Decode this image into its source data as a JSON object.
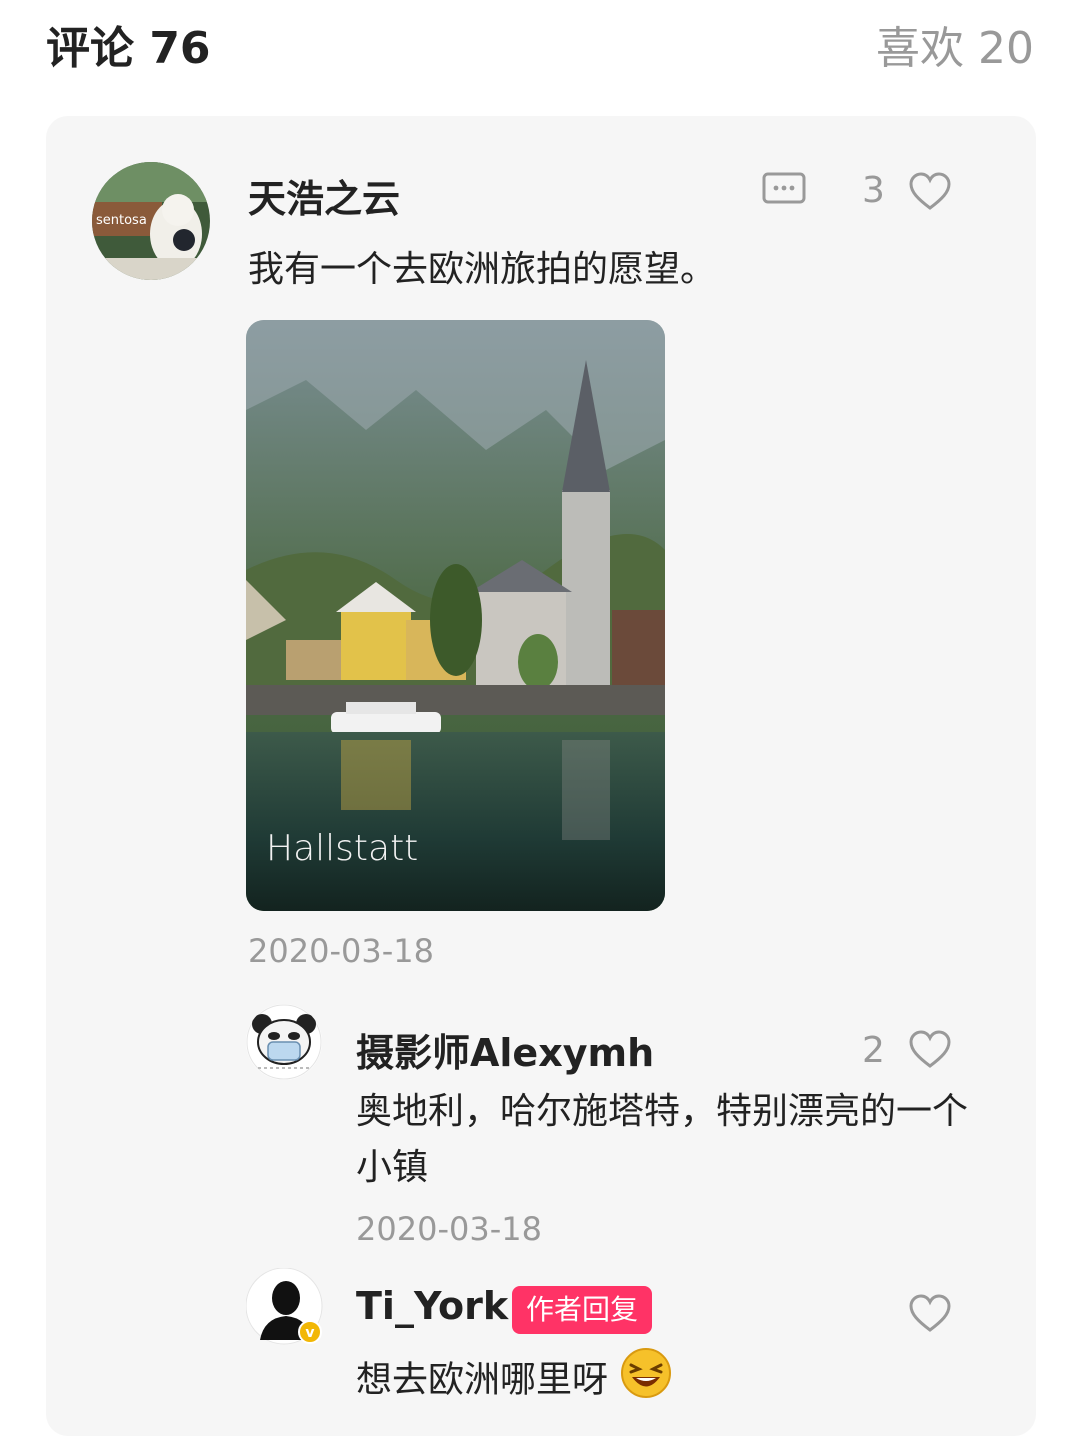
{
  "header": {
    "comments_label": "评论 76",
    "likes_label": "喜欢 20"
  },
  "comment": {
    "username": "天浩之云",
    "avatar_text": "sentosa",
    "text": "我有一个去欧洲旅拍的愿望。",
    "like_count": "3",
    "image_caption": "Hallstatt",
    "date": "2020-03-18"
  },
  "replies": [
    {
      "username": "摄影师Alexymh",
      "text": "奥地利，哈尔施塔特，特别漂亮的一个小镇",
      "like_count": "2",
      "date": "2020-03-18"
    },
    {
      "username": "Ti_York",
      "badge": "作者回复",
      "text": "想去欧洲哪里呀",
      "verified_mark": "v"
    }
  ],
  "colors": {
    "badge": "#ff3366",
    "muted": "#999999",
    "card_bg": "#f6f6f6"
  }
}
